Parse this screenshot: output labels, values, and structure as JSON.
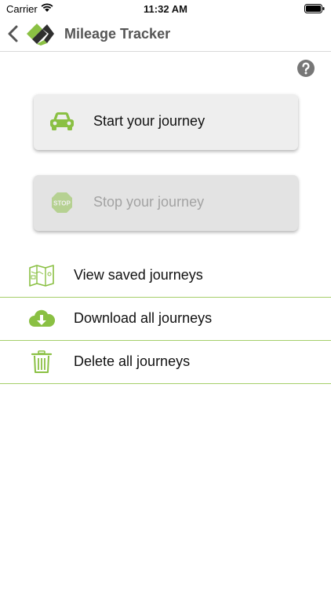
{
  "status_bar": {
    "carrier": "Carrier",
    "time": "11:32 AM"
  },
  "nav": {
    "title": "Mileage Tracker"
  },
  "colors": {
    "accent_green": "#8ac043",
    "logo_dark": "#3a3a3a",
    "disabled_text": "#a3a3a3",
    "help_grey": "#777777"
  },
  "buttons": {
    "start": {
      "label": "Start your journey",
      "icon": "car-icon"
    },
    "stop": {
      "label": "Stop your journey",
      "icon": "stop-sign-icon"
    }
  },
  "menu": [
    {
      "label": "View saved journeys",
      "icon": "map-icon"
    },
    {
      "label": "Download all journeys",
      "icon": "cloud-download-icon"
    },
    {
      "label": "Delete all journeys",
      "icon": "trash-icon"
    }
  ]
}
